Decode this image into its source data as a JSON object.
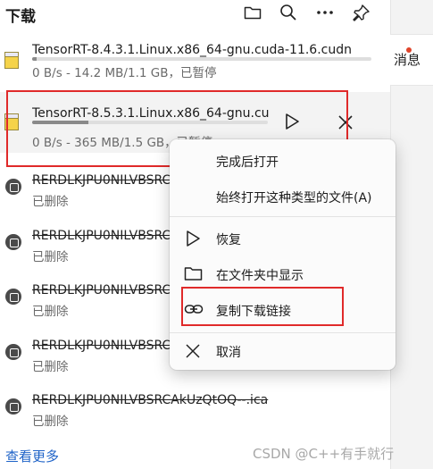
{
  "header": {
    "title": "下载"
  },
  "right_panel": {
    "label": "消息"
  },
  "downloads": [
    {
      "name": "TensorRT-8.4.3.1.Linux.x86_64-gnu.cuda-11.6.cudn",
      "status": "0 B/s - 14.2 MB/1.1 GB，已暂停",
      "progress": 0.013
    },
    {
      "name": "TensorRT-8.5.3.1.Linux.x86_64-gnu.cu",
      "status": "0 B/s - 365 MB/1.5 GB，已暂停",
      "progress": 0.24
    }
  ],
  "deleted_items": [
    {
      "name": "RERDLKJPU0NILVBSRC",
      "status": "已删除"
    },
    {
      "name": "RERDLKJPU0NILVBSRC",
      "status": "已删除"
    },
    {
      "name": "RERDLKJPU0NILVBSRC",
      "status": "已删除"
    },
    {
      "name": "RERDLKJPU0NILVBSRC",
      "status": "已删除"
    },
    {
      "name": "RERDLKJPU0NILVBSRCAkUzQtOQ--.ica",
      "status": "已删除"
    }
  ],
  "context_menu": {
    "open_when_done": "完成后打开",
    "always_open": "始终打开这种类型的文件(A)",
    "resume": "恢复",
    "show_in_folder": "在文件夹中显示",
    "copy_link": "复制下载链接",
    "cancel": "取消"
  },
  "footer": {
    "see_more": "查看更多",
    "watermark": "CSDN @C++有手就行"
  },
  "colors": {
    "highlight": "#e02a2a",
    "link": "#2064c8"
  }
}
